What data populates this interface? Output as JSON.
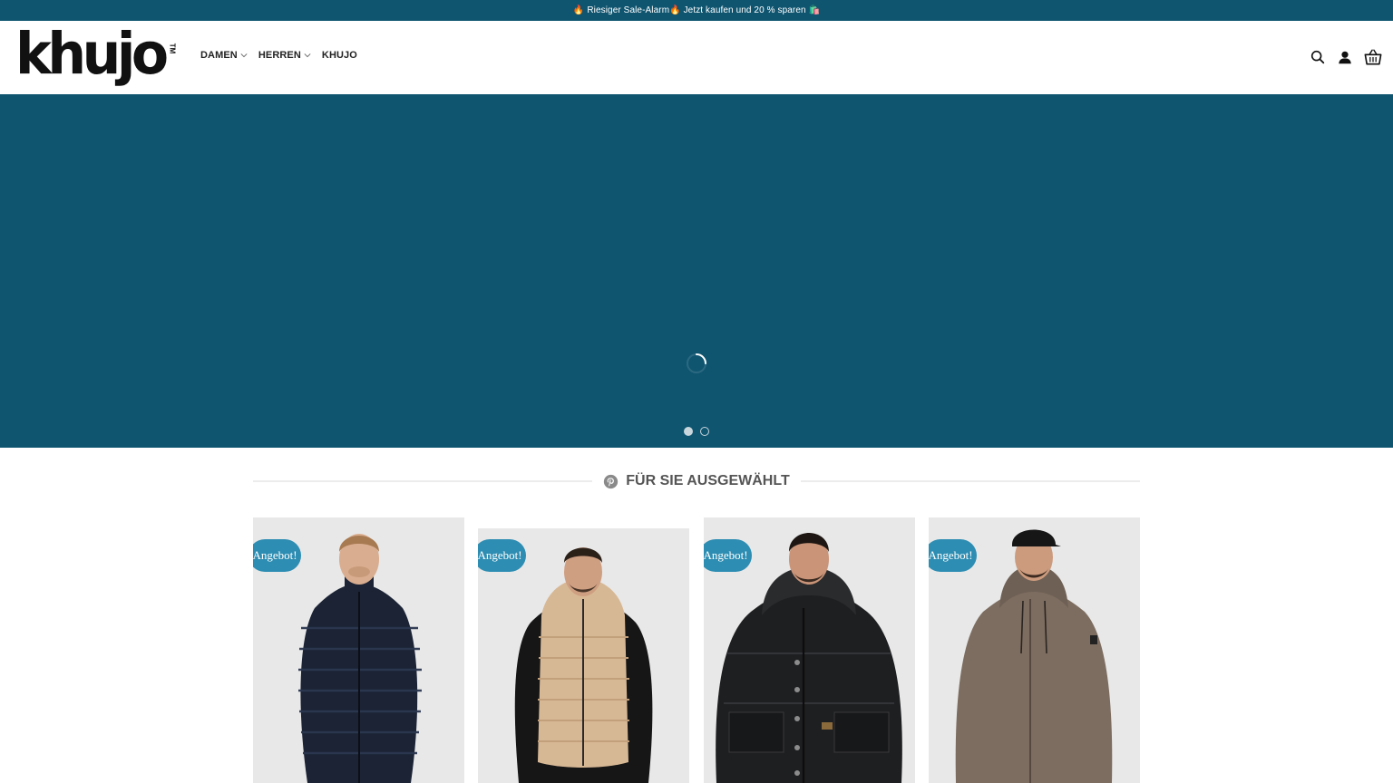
{
  "announcement": {
    "text": "🔥 Riesiger Sale-Alarm🔥 Jetzt kaufen und 20 % sparen 🛍️"
  },
  "header": {
    "logo_text": "khujo",
    "logo_tm": "TM",
    "nav": [
      {
        "label": "DAMEN",
        "has_dropdown": true
      },
      {
        "label": "HERREN",
        "has_dropdown": true
      },
      {
        "label": "KHUJO",
        "has_dropdown": false
      }
    ],
    "icons": [
      "search-icon",
      "account-icon",
      "cart-icon"
    ]
  },
  "hero": {
    "state": "loading",
    "slides": 2,
    "active_slide": 1
  },
  "section": {
    "title": "FÜR SIE AUSGEWÄHLT",
    "icon": "pinterest-icon"
  },
  "products": [
    {
      "badge": "Angebot!",
      "item": "navy puffer jacket"
    },
    {
      "badge": "Angebot!",
      "item": "beige hooded puffer vest"
    },
    {
      "badge": "Angebot!",
      "item": "black hooded winter parka"
    },
    {
      "badge": "Angebot!",
      "item": "taupe hooded rain parka"
    }
  ],
  "colors": {
    "brand": "#0f5570",
    "badge": "#2d8db2",
    "card_bg": "#e8e8e8",
    "section_title": "#555555"
  }
}
